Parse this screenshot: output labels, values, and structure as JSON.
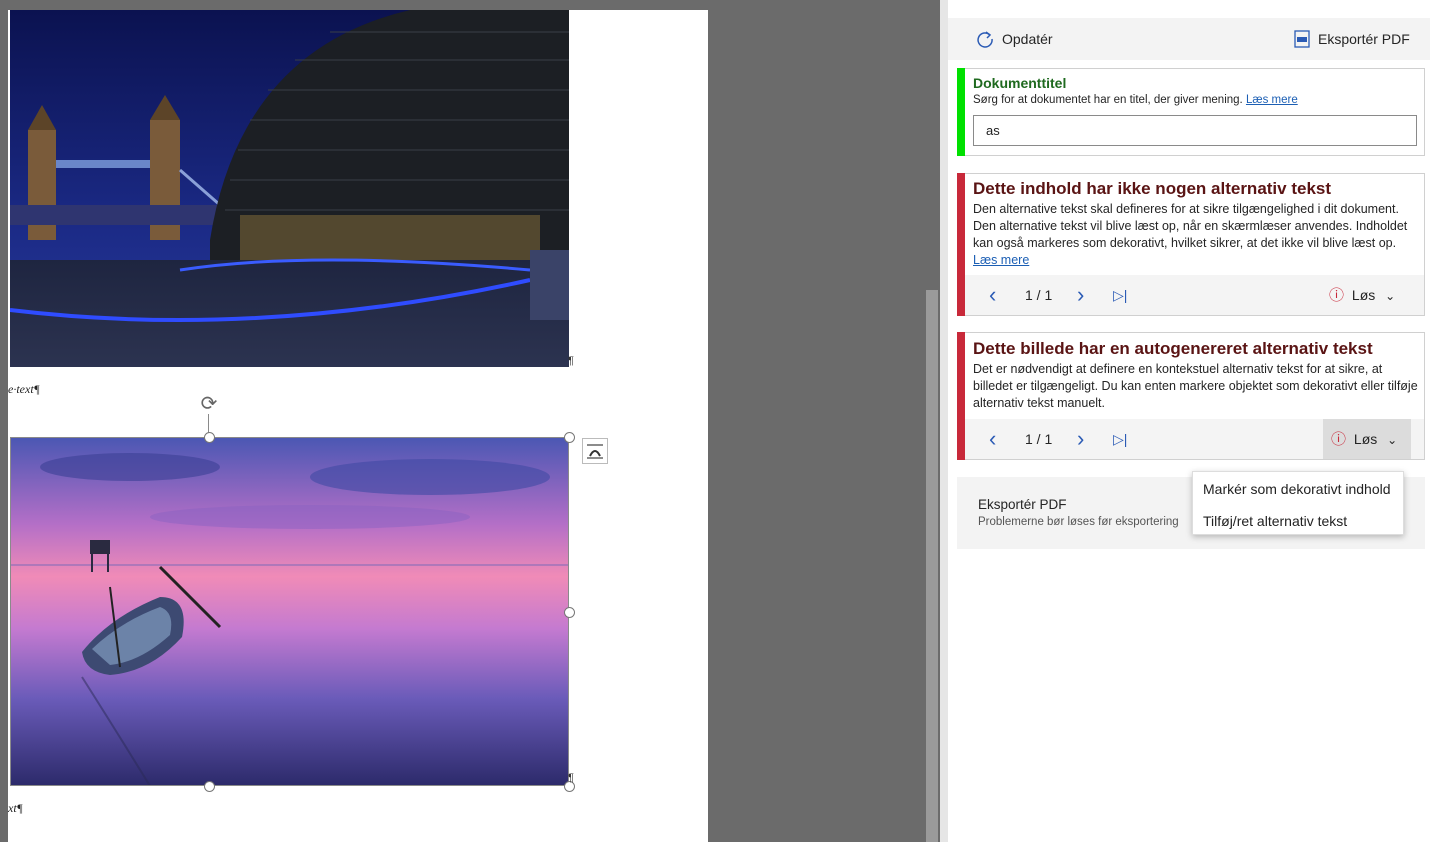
{
  "document": {
    "caption_1": "e·text¶",
    "caption_2": "xt¶",
    "pilcrow": "¶"
  },
  "pane": {
    "toolbar": {
      "refresh_label": "Opdatér",
      "export_label": "Eksportér PDF"
    },
    "title_card": {
      "heading": "Dokumenttitel",
      "description": "Sørg for at dokumentet har en titel, der giver mening.",
      "link": "Læs mere",
      "input_value": "as",
      "accent": "#00e000"
    },
    "issue_1": {
      "heading": "Dette indhold har ikke nogen alternativ tekst",
      "body": "Den alternative tekst skal defineres for at sikre tilgængelighed i dit dokument. Den alternative tekst vil blive læst op, når en skærmlæser anvendes. Indholdet kan også markeres som dekorativt, hvilket sikrer, at det ikke vil blive læst op.",
      "link": "Læs mere",
      "counter": "1 / 1",
      "fix_label": "Løs",
      "accent": "#c8293a"
    },
    "issue_2": {
      "heading": "Dette billede har en autogenereret alternativ tekst",
      "body": "Det er nødvendigt at definere en kontekstuel alternativ tekst for at sikre, at billedet er tilgængeligt. Du kan enten markere objektet som dekorativt eller tilføje alternativ tekst manuelt.",
      "counter": "1 / 1",
      "fix_label": "Løs",
      "accent": "#c8293a"
    },
    "export_section": {
      "title": "Eksportér PDF",
      "subtitle": "Problemerne bør løses før eksportering"
    },
    "fix_menu": {
      "items": [
        "Markér som dekorativt indhold",
        "Tilføj/ret alternativ tekst"
      ]
    }
  }
}
